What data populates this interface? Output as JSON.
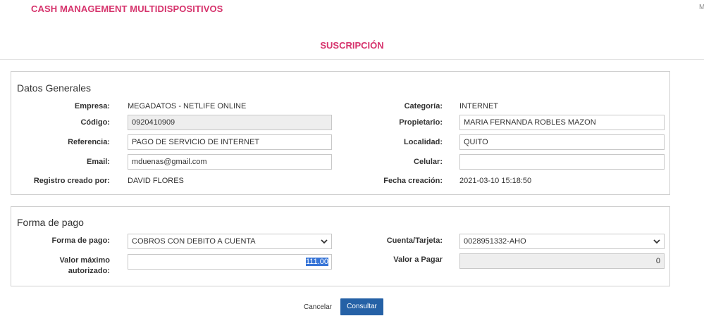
{
  "header": {
    "app_title": "CASH MANAGEMENT MULTIDISPOSITIVOS",
    "corner_text": "M",
    "page_title": "SUSCRIPCIÓN"
  },
  "general": {
    "legend": "Datos Generales",
    "empresa_label": "Empresa:",
    "empresa_value": "MEGADATOS - NETLIFE ONLINE",
    "categoria_label": "Categoría:",
    "categoria_value": "INTERNET",
    "codigo_label": "Código:",
    "codigo_value": "0920410909",
    "propietario_label": "Propietario:",
    "propietario_value": "MARIA FERNANDA ROBLES MAZON",
    "referencia_label": "Referencia:",
    "referencia_value": "PAGO DE SERVICIO DE INTERNET",
    "localidad_label": "Localidad:",
    "localidad_value": "QUITO",
    "email_label": "Email:",
    "email_value": "mduenas@gmail.com",
    "celular_label": "Celular:",
    "celular_value": "",
    "registro_label": "Registro creado por:",
    "registro_value": "DAVID FLORES",
    "fecha_label": "Fecha creación:",
    "fecha_value": "2021-03-10 15:18:50"
  },
  "payment": {
    "legend": "Forma de pago",
    "forma_label": "Forma de pago:",
    "forma_value": "COBROS CON DEBITO A CUENTA",
    "cuenta_label": "Cuenta/Tarjeta:",
    "cuenta_value": "0028951332-AHO",
    "valor_max_label_1": "Valor máximo",
    "valor_max_label_2": "autorizado:",
    "valor_max_value": "111.00",
    "valor_pagar_label": "Valor a Pagar",
    "valor_pagar_value": "0"
  },
  "actions": {
    "cancel_label": "Cancelar",
    "consult_label": "Consultar"
  },
  "colors": {
    "accent_pink": "#d6336c",
    "primary_button": "#2561a6",
    "selection": "#3875d7"
  },
  "icons": {
    "select_arrow": "chevron-down-icon"
  }
}
